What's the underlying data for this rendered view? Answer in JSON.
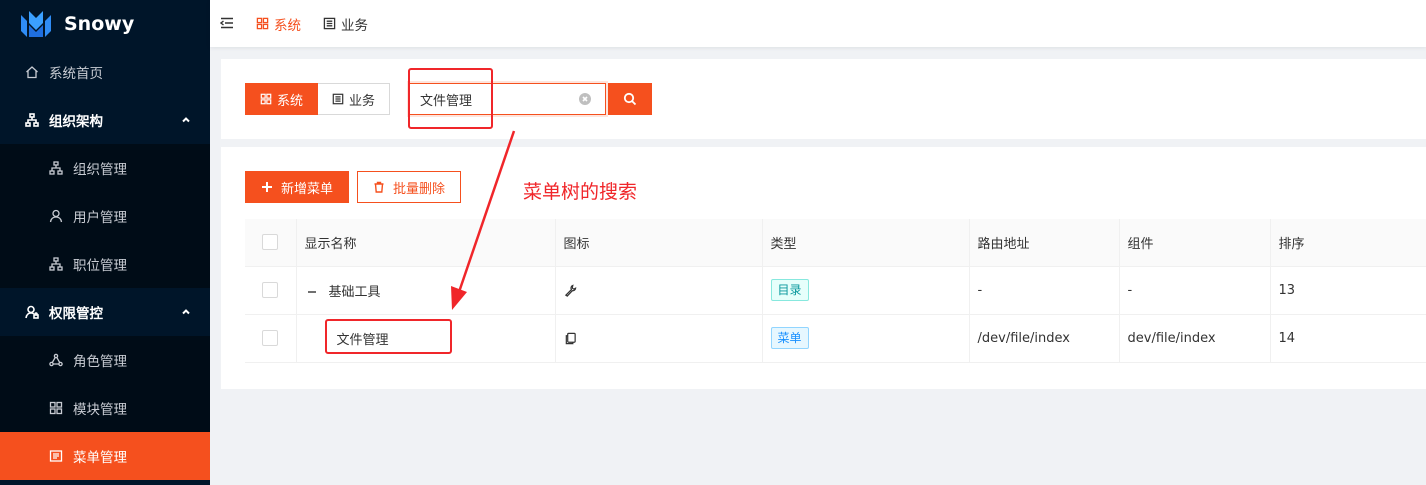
{
  "app": {
    "name": "Snowy"
  },
  "sidebar": {
    "items": [
      {
        "label": "系统首页",
        "kind": "top",
        "icon": "home-icon"
      },
      {
        "label": "组织架构",
        "kind": "group",
        "icon": "org-tree-icon"
      },
      {
        "label": "组织管理",
        "kind": "sub",
        "icon": "org-tree-icon"
      },
      {
        "label": "用户管理",
        "kind": "sub",
        "icon": "user-icon"
      },
      {
        "label": "职位管理",
        "kind": "sub",
        "icon": "org-tree-icon"
      },
      {
        "label": "权限管控",
        "kind": "group",
        "icon": "user-lock-icon"
      },
      {
        "label": "角色管理",
        "kind": "sub",
        "icon": "role-nodes-icon"
      },
      {
        "label": "模块管理",
        "kind": "sub",
        "icon": "module-grid-icon"
      },
      {
        "label": "菜单管理",
        "kind": "sub-active",
        "icon": "menu-list-icon"
      }
    ]
  },
  "header": {
    "tabs": [
      {
        "label": "系统",
        "active": true,
        "icon": "module-grid-icon"
      },
      {
        "label": "业务",
        "active": false,
        "icon": "document-list-icon"
      }
    ]
  },
  "search": {
    "segments": [
      {
        "label": "系统",
        "selected": true,
        "icon": "module-grid-icon"
      },
      {
        "label": "业务",
        "selected": false,
        "icon": "document-list-icon"
      }
    ],
    "value": "文件管理"
  },
  "toolbar": {
    "add_label": "新增菜单",
    "batch_delete_label": "批量删除"
  },
  "annotation": {
    "text": "菜单树的搜索"
  },
  "table": {
    "columns": [
      "显示名称",
      "图标",
      "类型",
      "路由地址",
      "组件",
      "排序"
    ],
    "rows": [
      {
        "name": "基础工具",
        "icon": "tool-wrench-icon",
        "type": "目录",
        "path": "-",
        "component": "-",
        "sort": "13",
        "expanded": true,
        "level": 0
      },
      {
        "name": "文件管理",
        "icon": "copy-icon",
        "type": "菜单",
        "path": "/dev/file/index",
        "component": "dev/file/index",
        "sort": "14",
        "level": 1
      }
    ]
  },
  "colors": {
    "primary": "#f5501e",
    "sidebar_bg": "#001529",
    "annotation": "#f0262a"
  }
}
